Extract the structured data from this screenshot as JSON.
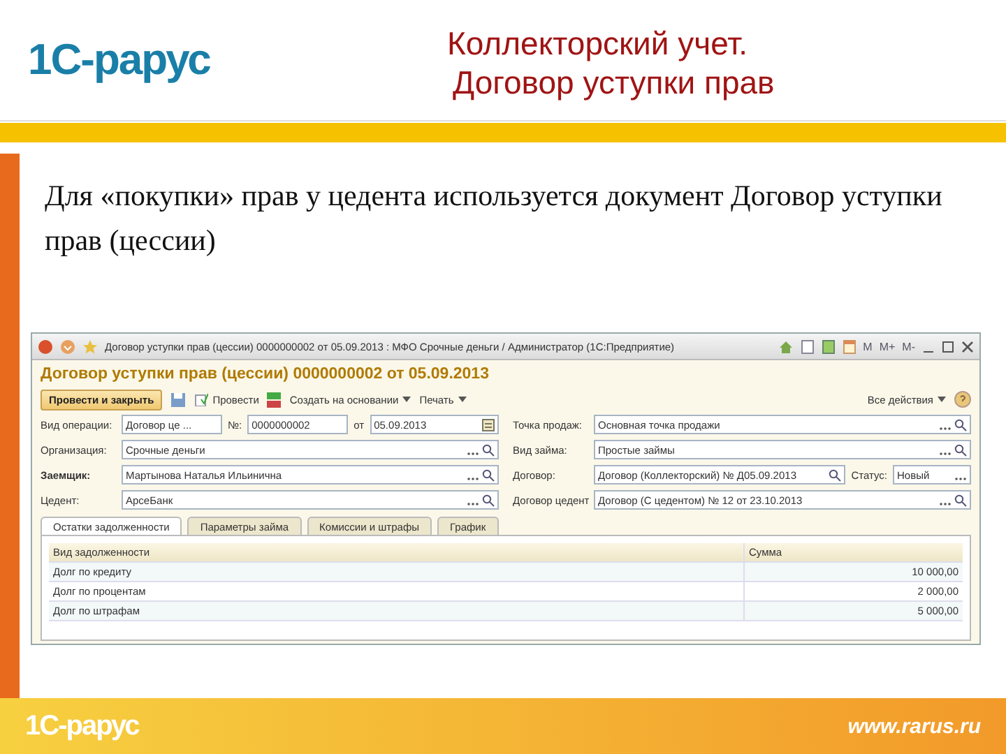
{
  "slide": {
    "logo": "1С-рарус",
    "title_lines": [
      "Коллекторский учет.",
      "Договор уступки прав"
    ],
    "body": "Для «покупки» прав у цедента используется документ Договор уступки прав (цессии)",
    "footer_logo": "1С-рарус",
    "footer_url": "www.rarus.ru"
  },
  "window": {
    "title": "Договор уступки прав (цессии) 0000000002 от 05.09.2013 : МФО Срочные деньги / Администратор  (1С:Предприятие)",
    "memory_buttons": [
      "M",
      "M+",
      "M-"
    ],
    "heading": "Договор уступки прав (цессии) 0000000002 от 05.09.2013",
    "commands": [
      {
        "label": "Провести и закрыть",
        "kind": "default"
      },
      {
        "kind": "save"
      },
      {
        "label": "Провести",
        "kind": "post"
      },
      {
        "kind": "dtkt"
      },
      {
        "label": "Создать на основании",
        "kind": "menu"
      },
      {
        "label": "Печать",
        "kind": "menu"
      }
    ],
    "all_actions": "Все действия",
    "field_rows": [
      {
        "left": [
          {
            "label": "Вид операции:",
            "value": "Договор це ...",
            "kind": "plain",
            "bold": false
          },
          {
            "label": "№:",
            "value": "0000000002",
            "kind": "plain",
            "bold": false
          },
          {
            "label": "от",
            "value": "05.09.2013",
            "kind": "date",
            "bold": false
          }
        ],
        "right": [
          {
            "label": "Точка продаж:",
            "value": "Основная точка продажи",
            "kind": "lookup",
            "bold": false
          }
        ]
      },
      {
        "left": [
          {
            "label": "Организация:",
            "value": "Срочные деньги",
            "kind": "lookup",
            "bold": false
          }
        ],
        "right": [
          {
            "label": "Вид займа:",
            "value": "Простые займы",
            "kind": "lookup",
            "bold": false
          }
        ]
      },
      {
        "left": [
          {
            "label": "Заемщик:",
            "value": "Мартынова Наталья Ильинична",
            "kind": "lookup",
            "bold": true
          }
        ],
        "right": [
          {
            "label": "Договор:",
            "value": "Договор (Коллекторский) № Д05.09.2013",
            "kind": "search",
            "bold": false
          },
          {
            "label": "Статус:",
            "value": "Новый",
            "kind": "select",
            "bold": false
          }
        ]
      },
      {
        "left": [
          {
            "label": "Цедент:",
            "value": "АрсеБанк",
            "kind": "lookup",
            "bold": false
          }
        ],
        "right": [
          {
            "label": "Договор цедент",
            "value": "Договор (С цедентом) № 12 от 23.10.2013",
            "kind": "lookup",
            "bold": false
          }
        ]
      }
    ],
    "tabs": [
      {
        "label": "Остатки задолженности",
        "selected": true
      },
      {
        "label": "Параметры займа",
        "selected": false
      },
      {
        "label": "Комиссии и штрафы",
        "selected": false
      },
      {
        "label": "График",
        "selected": false
      }
    ],
    "table": {
      "columns": [
        "Вид задолженности",
        "Сумма"
      ],
      "rows": [
        [
          "Долг по кредиту",
          "10 000,00"
        ],
        [
          "Долг по процентам",
          "2 000,00"
        ],
        [
          "Долг по штрафам",
          "5 000,00"
        ]
      ]
    }
  }
}
